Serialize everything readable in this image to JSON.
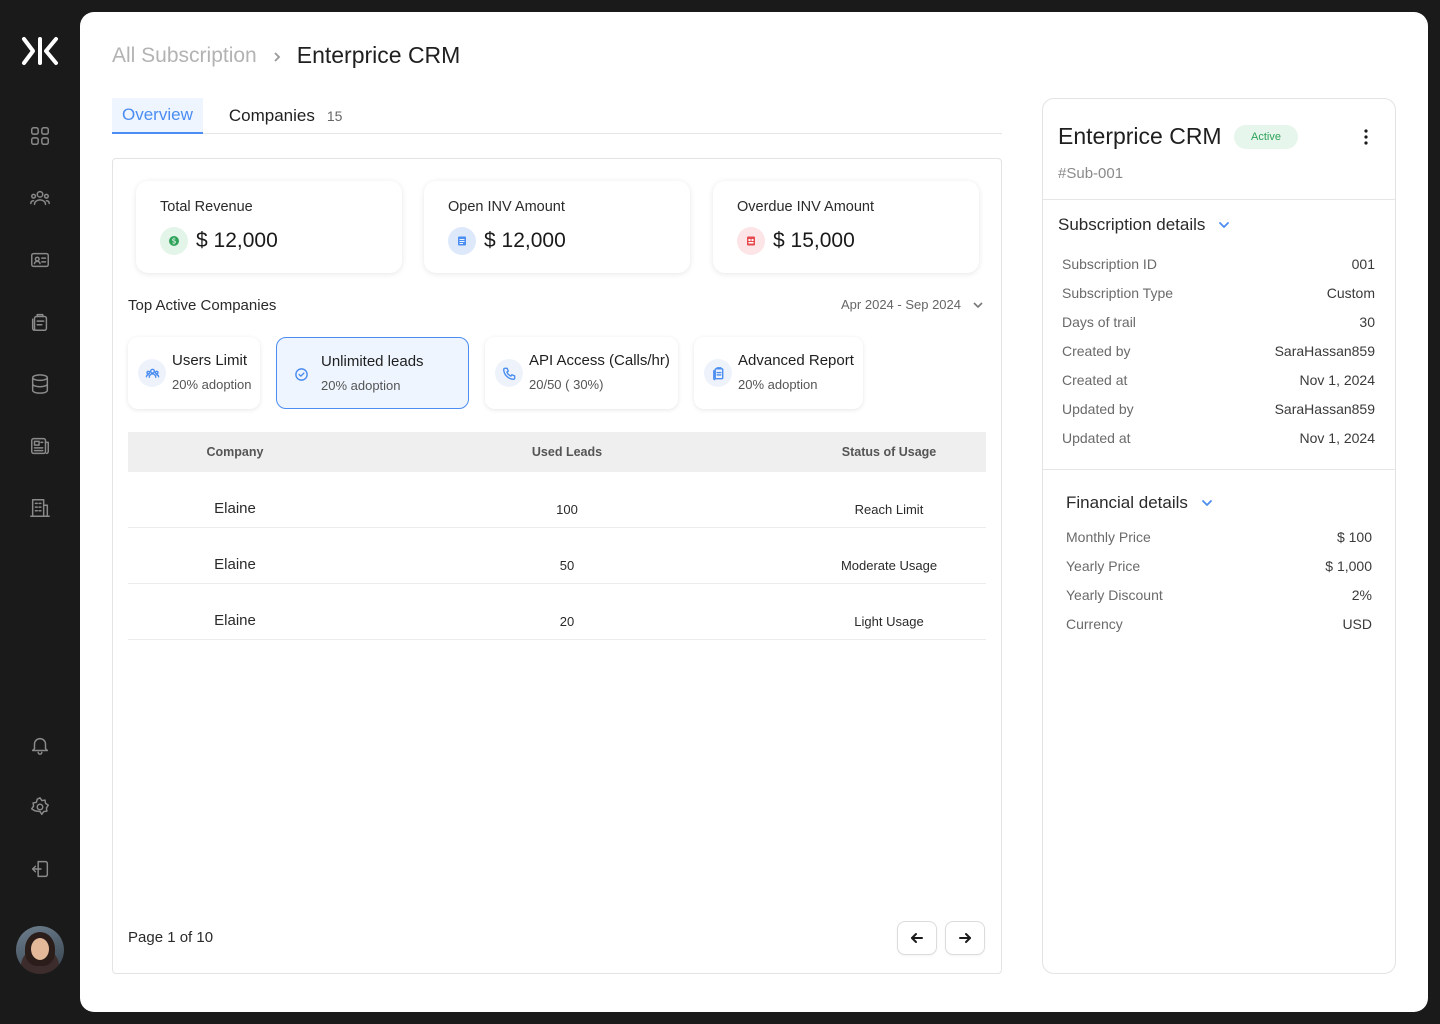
{
  "sidebar": {
    "nav": [
      "dashboard-icon",
      "users-icon",
      "id-card-icon",
      "clipboard-icon",
      "database-icon",
      "report-icon",
      "building-icon",
      "bell-icon",
      "gear-icon",
      "logout-icon"
    ]
  },
  "breadcrumb": {
    "parent": "All Subscription",
    "current": "Enterprice CRM"
  },
  "tabs": [
    {
      "label": "Overview"
    },
    {
      "label": "Companies",
      "count": "15"
    }
  ],
  "stats": [
    {
      "label": "Total Revenue",
      "value": "$ 12,000",
      "icon": "dollar-icon",
      "color": "#2fa35a"
    },
    {
      "label": "Open INV Amount",
      "value": "$ 12,000",
      "icon": "document-icon",
      "color": "#4b8df0"
    },
    {
      "label": "Overdue INV Amount",
      "value": "$ 15,000",
      "icon": "invoice-icon",
      "color": "#e5484d"
    }
  ],
  "top_companies": {
    "title": "Top Active Companies",
    "date_range": "Apr 2024 - Sep 2024"
  },
  "features": [
    {
      "title": "Users Limit",
      "sub": "20% adoption",
      "icon": "users-icon"
    },
    {
      "title": "Unlimited leads",
      "sub": "20% adoption",
      "icon": "check-circle-icon"
    },
    {
      "title": "API Access (Calls/hr)",
      "sub": "20/50 ( 30%)",
      "icon": "phone-icon"
    },
    {
      "title": "Advanced Report",
      "sub": "20% adoption",
      "icon": "report-icon"
    }
  ],
  "table": {
    "headers": [
      "Company",
      "Used Leads",
      "Status of Usage"
    ],
    "rows": [
      [
        "Elaine",
        "100",
        "Reach Limit"
      ],
      [
        "Elaine",
        "50",
        "Moderate Usage"
      ],
      [
        "Elaine",
        "20",
        "Light Usage"
      ]
    ]
  },
  "pagination": {
    "label": "Page 1 of 10"
  },
  "panel": {
    "title": "Enterprice CRM",
    "status": "Active",
    "id": "#Sub-001",
    "subscription_title": "Subscription details",
    "subscription": [
      {
        "k": "Subscription ID",
        "v": "001"
      },
      {
        "k": "Subscription Type",
        "v": "Custom"
      },
      {
        "k": "Days of trail",
        "v": "30"
      },
      {
        "k": "Created by",
        "v": "SaraHassan859"
      },
      {
        "k": "Created at",
        "v": "Nov 1, 2024"
      },
      {
        "k": "Updated by",
        "v": "SaraHassan859"
      },
      {
        "k": "Updated at",
        "v": "Nov 1, 2024"
      }
    ],
    "financial_title": "Financial details",
    "financial": [
      {
        "k": "Monthly Price",
        "v": "$ 100"
      },
      {
        "k": "Yearly Price",
        "v": "$ 1,000"
      },
      {
        "k": "Yearly Discount",
        "v": "2%"
      },
      {
        "k": "Currency",
        "v": "USD"
      }
    ]
  }
}
